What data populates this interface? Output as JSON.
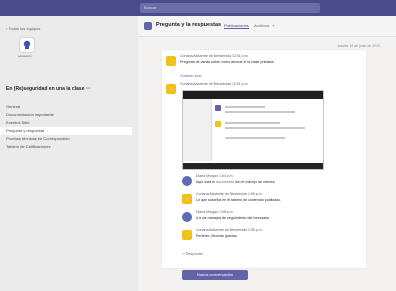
{
  "topbar": {
    "search_placeholder": "Buscar"
  },
  "sidebar": {
    "back_label": "‹ Todos los equipos",
    "team_sublabel": "educación",
    "team_name": "En (Re)seguridad en una la clase ···",
    "channels": [
      "General",
      "Documentación importante",
      "Eventos Sitio",
      "Pregunta y respuesta",
      "Pruebas técnicas en Correspondido",
      "Tablero de Calificaciones"
    ],
    "active_index": 3
  },
  "header": {
    "title": "Pregunta y la respuestas",
    "tabs": [
      "Publicaciones",
      "Archivos",
      "+"
    ]
  },
  "thread": {
    "date": "Jueves 19 de junio de 2020",
    "first": {
      "author": "Cortana/Asistente de Bienvenida  12:51 p.m.",
      "text": "Pregunta de varias sobre cómo ahorrar el la clase primaria."
    },
    "see_more": "Contraer todo",
    "second_author": "Cortana/Asistente de Bienvenida  12:51 p.m.",
    "messages": [
      {
        "author": "Diana Morgan  1:54 p.m.",
        "text": "Aquí está el ",
        "link": "documento",
        "text2": " con el manejo de carrera."
      },
      {
        "author": "Cortana/Asistente de Bienvenida  1:55 p.m.",
        "text": "Lo que suscriba en el tablero de contenido publicado."
      },
      {
        "author": "Diana Morgan  1:58 p.m.",
        "text": "ir a los manejos de seguimiento del formulario."
      },
      {
        "author": "Cortana/Asistente de Bienvenida  1:58 p.m.",
        "text": "Perfecto. Muchas gracias."
      }
    ],
    "reply": "↩ Responder"
  },
  "new_conversation": "Nueva conversación",
  "colors": {
    "brand": "#6264a7",
    "topbar": "#4b4c8c",
    "bot_yellow": "#f1c21b"
  }
}
